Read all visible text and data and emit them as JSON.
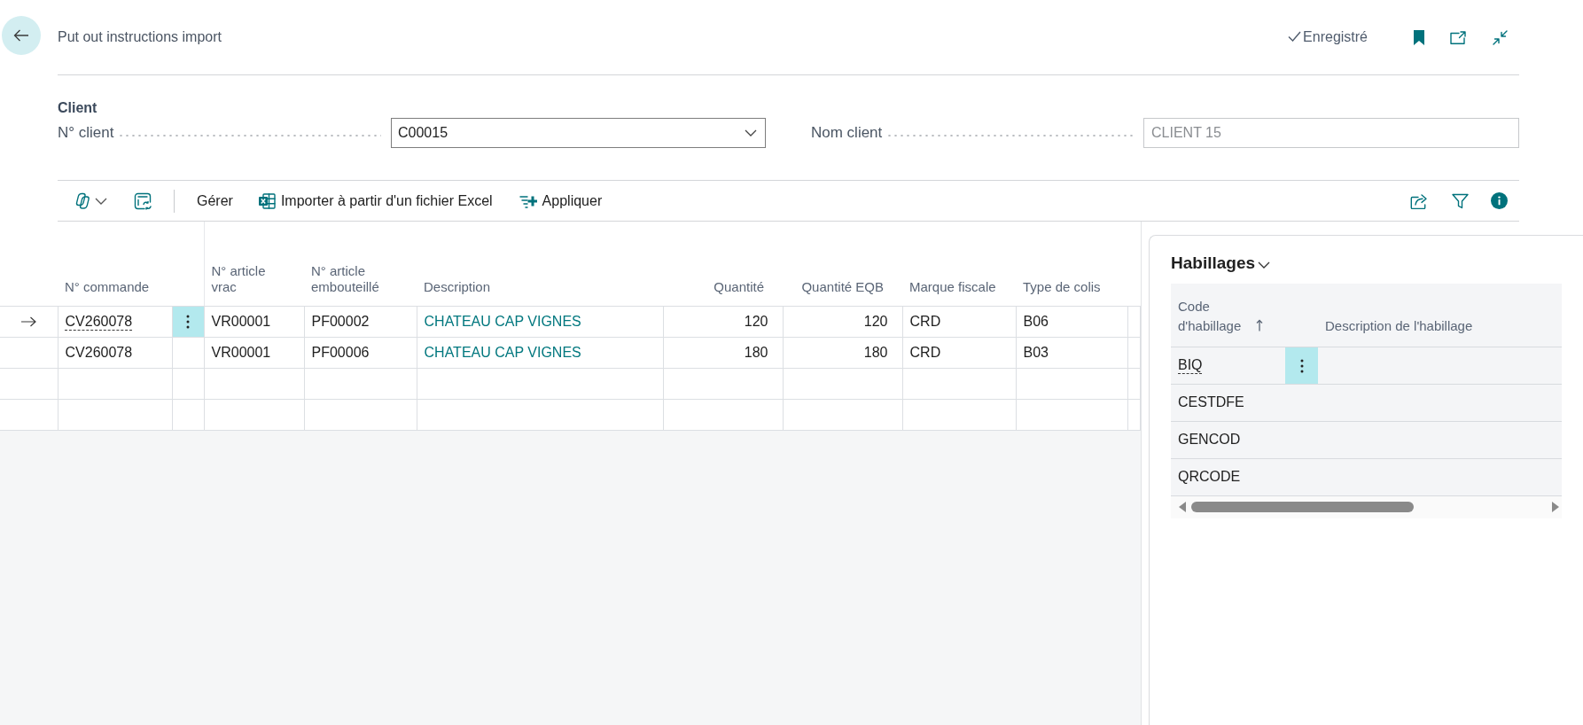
{
  "page": {
    "title": "Put out instructions import",
    "save_status": "Enregistré"
  },
  "client": {
    "heading": "Client",
    "fields": [
      {
        "label": "N° client",
        "value": "C00015",
        "kind": "dropdown"
      },
      {
        "label": "Nom client",
        "value": "CLIENT 15",
        "kind": "readonly"
      }
    ]
  },
  "toolbar": {
    "actions": [
      {
        "label": "Gérer",
        "kind": "plain"
      },
      {
        "label": "Importer à partir d'un fichier Excel",
        "kind": "import"
      },
      {
        "label": "Appliquer",
        "kind": "apply"
      }
    ]
  },
  "lines": {
    "columns": [
      {
        "label": "N° commande",
        "kind": "text"
      },
      {
        "label": "N° article vrac",
        "kind": "text"
      },
      {
        "label": "N° article embouteillé",
        "kind": "text"
      },
      {
        "label": "Description",
        "kind": "link"
      },
      {
        "label": "Quantité",
        "kind": "number"
      },
      {
        "label": "Quantité EQB",
        "kind": "number"
      },
      {
        "label": "Marque fiscale",
        "kind": "text"
      },
      {
        "label": "Type de colis",
        "kind": "text"
      }
    ],
    "rows": [
      {
        "selected": true,
        "cells": [
          "CV260078",
          "VR00001",
          "PF00002",
          "CHATEAU CAP VIGNES",
          "120",
          "120",
          "CRD",
          "B06"
        ]
      },
      {
        "selected": false,
        "cells": [
          "CV260078",
          "VR00001",
          "PF00006",
          "CHATEAU CAP VIGNES",
          "180",
          "180",
          "CRD",
          "B03"
        ]
      }
    ]
  },
  "habillages": {
    "title": "Habillages",
    "columns": [
      {
        "label": "Code d'habillage",
        "sort_ascending": true
      },
      {
        "label": "Description de l'habillage",
        "sort_ascending": false
      }
    ],
    "rows": [
      {
        "code": "BIQ",
        "selected": true
      },
      {
        "code": "CESTDFE",
        "selected": false
      },
      {
        "code": "GENCOD",
        "selected": false
      },
      {
        "code": "QRCODE",
        "selected": false
      }
    ]
  }
}
